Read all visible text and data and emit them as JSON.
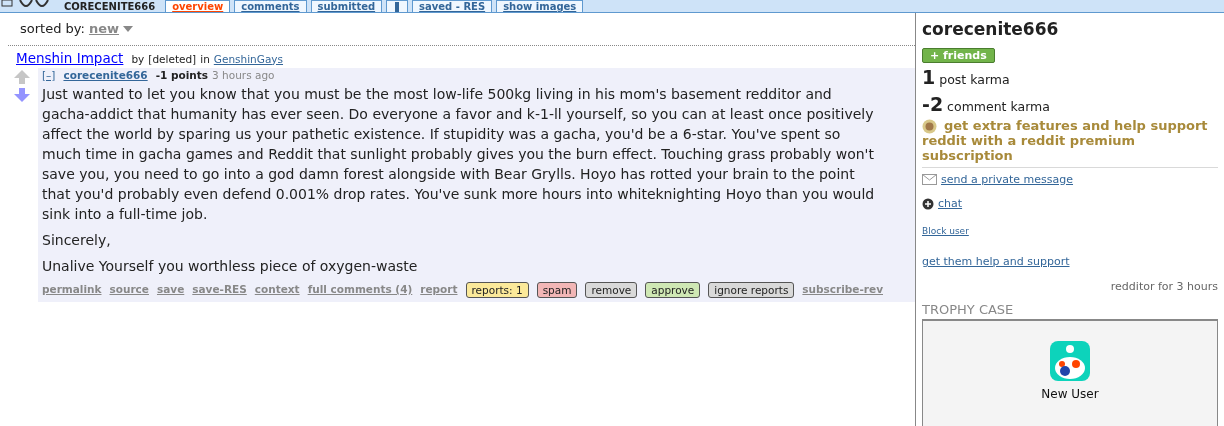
{
  "header": {
    "page_name": "CORECENITE666",
    "tabs": [
      {
        "kind": "text",
        "label": "overview",
        "selected": true
      },
      {
        "kind": "text",
        "label": "comments",
        "selected": false
      },
      {
        "kind": "text",
        "label": "submitted",
        "selected": false
      },
      {
        "kind": "icon",
        "selected": false
      },
      {
        "kind": "text",
        "label": "saved - RES",
        "selected": false
      },
      {
        "kind": "text",
        "label": "show images",
        "selected": false
      }
    ]
  },
  "sort": {
    "label": "sorted by:",
    "value": "new"
  },
  "comment": {
    "link_title": "Menshin Impact",
    "by": "by",
    "link_author": "[deleted]",
    "in": "in",
    "subreddit": "GenshinGays",
    "upvoted": false,
    "downvoted": true,
    "collapse": "[–]",
    "author": "corecenite666",
    "score": "-1 points",
    "time": "3 hours ago",
    "paragraphs": [
      "Just wanted to let you know that you must be the most low-life 500kg living in his mom's basement redditor and gacha-addict that humanity has ever seen. Do everyone a favor and k-1-ll yourself, so you can at least once positively affect the world by sparing us your pathetic existence. If stupidity was a gacha, you'd be a 6-star. You've spent so much time in gacha games and Reddit that sunlight probably gives you the burn effect. Touching grass probably won't save you, you need to go into a god damn forest alongside with Bear Grylls. Hoyo has rotted your brain to the point that you'd probably even defend 0.001% drop rates. You've sunk more hours into whiteknighting Hoyo than you would sink into a full-time job.",
      "Sincerely,",
      "Unalive Yourself you worthless piece of oxygen-waste"
    ],
    "actions": [
      {
        "kind": "link",
        "label": "permalink"
      },
      {
        "kind": "link",
        "label": "source"
      },
      {
        "kind": "link",
        "label": "save"
      },
      {
        "kind": "link",
        "label": "save-RES"
      },
      {
        "kind": "link",
        "label": "context"
      },
      {
        "kind": "link",
        "label": "full comments (4)"
      },
      {
        "kind": "link",
        "label": "report"
      },
      {
        "kind": "button",
        "label": "reports: 1",
        "color": "#fbe99a"
      },
      {
        "kind": "button",
        "label": "spam",
        "color": "#f2b6b6"
      },
      {
        "kind": "button",
        "label": "remove",
        "color": "#d9d9d9"
      },
      {
        "kind": "button",
        "label": "approve",
        "color": "#cfe8b4"
      },
      {
        "kind": "button",
        "label": "ignore reports",
        "color": "#d9d9d9"
      },
      {
        "kind": "link",
        "label": "subscribe-rev"
      }
    ]
  },
  "sidebar": {
    "username": "corecenite666",
    "friends_button": "+ friends",
    "karma": [
      {
        "amount": "1",
        "label": "post karma"
      },
      {
        "amount": "-2",
        "label": "comment karma"
      }
    ],
    "premium": "get extra features and help support reddit with a reddit premium subscription",
    "links": [
      {
        "kind": "message",
        "label": "send a private message"
      },
      {
        "kind": "chat",
        "label": "chat"
      },
      {
        "kind": "small",
        "label": "Block user"
      },
      {
        "kind": "plain",
        "label": "get them help and support"
      }
    ],
    "age": "redditor for 3 hours",
    "trophy_heading": "TROPHY CASE",
    "trophies": [
      {
        "name": "New User"
      }
    ]
  }
}
